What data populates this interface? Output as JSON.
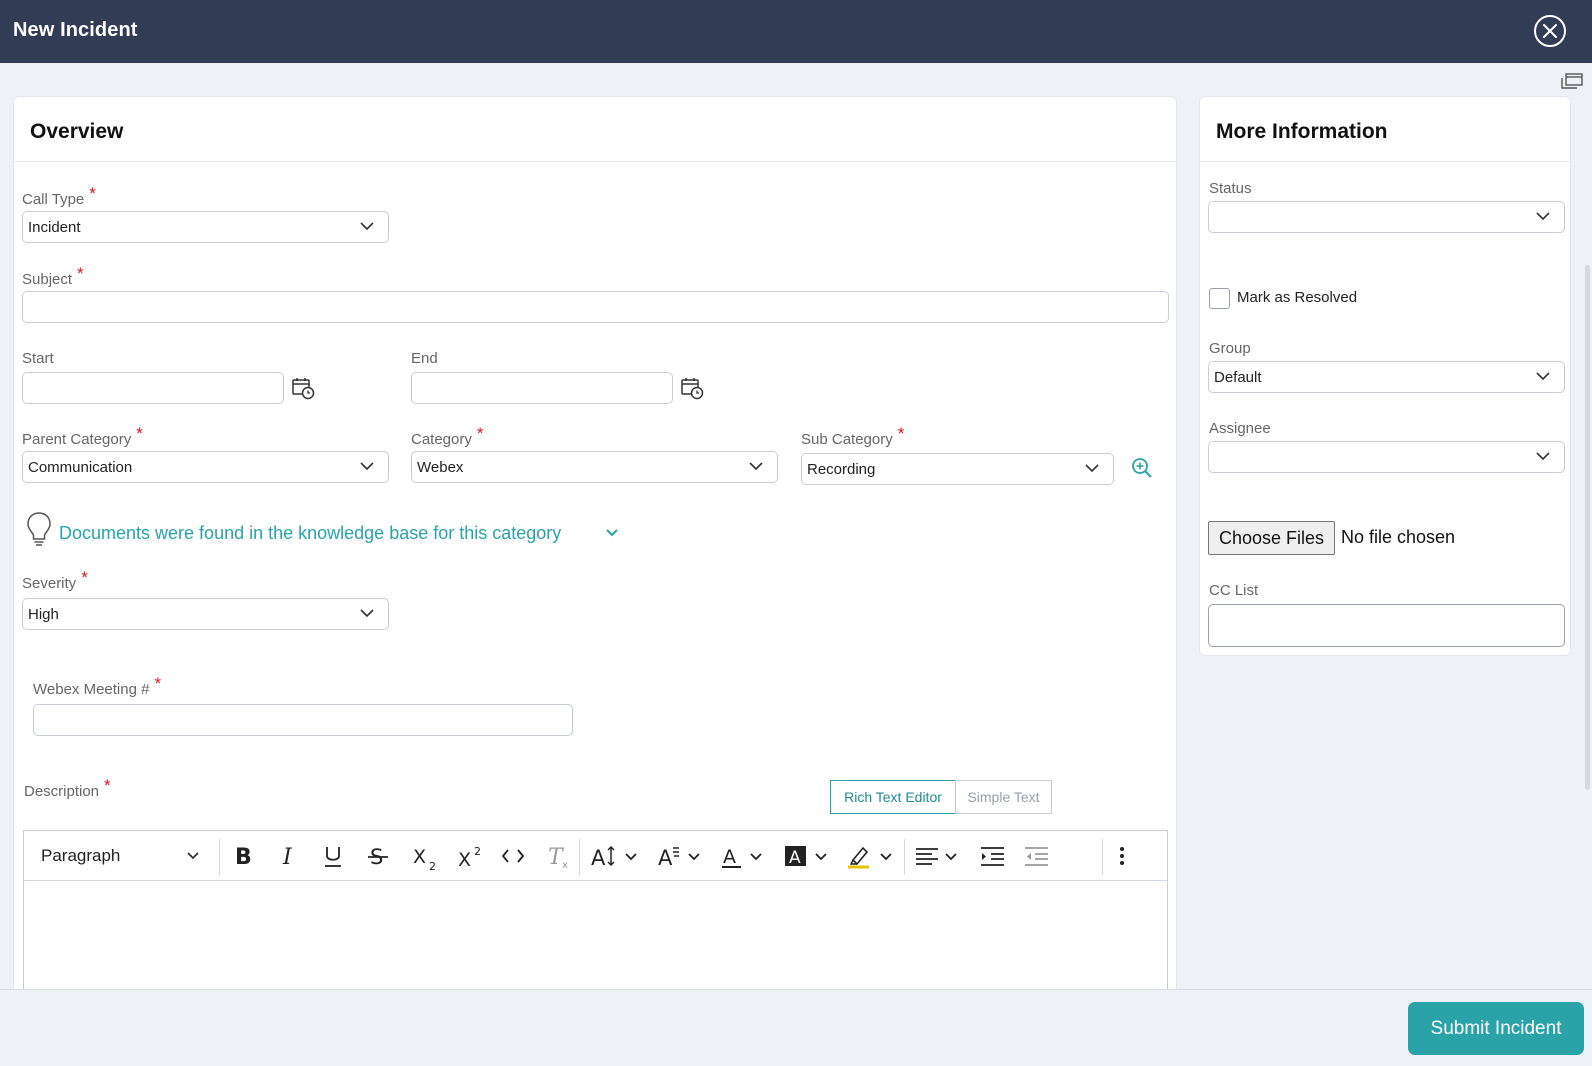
{
  "window": {
    "title": "New Incident"
  },
  "overview": {
    "title": "Overview",
    "call_type": {
      "label": "Call Type",
      "value": "Incident"
    },
    "subject": {
      "label": "Subject",
      "value": ""
    },
    "start": {
      "label": "Start",
      "value": ""
    },
    "end": {
      "label": "End",
      "value": ""
    },
    "parent_category": {
      "label": "Parent Category",
      "value": "Communication"
    },
    "category": {
      "label": "Category",
      "value": "Webex"
    },
    "sub_category": {
      "label": "Sub Category",
      "value": "Recording"
    },
    "knowledge_base": {
      "message": "Documents were found in the knowledge base for this category"
    },
    "severity": {
      "label": "Severity",
      "value": "High"
    },
    "webex_meeting": {
      "label": "Webex Meeting #",
      "value": ""
    },
    "description": {
      "label": "Description",
      "mode_rich": "Rich Text Editor",
      "mode_simple": "Simple Text",
      "active_mode": "Rich Text Editor",
      "paragraph_style": "Paragraph"
    },
    "required_marker": "*"
  },
  "more_info": {
    "title": "More Information",
    "status": {
      "label": "Status",
      "value": ""
    },
    "mark_resolved": {
      "label": "Mark as Resolved",
      "checked": false
    },
    "group": {
      "label": "Group",
      "value": "Default"
    },
    "assignee": {
      "label": "Assignee",
      "value": ""
    },
    "files": {
      "button": "Choose Files",
      "status": "No file chosen"
    },
    "cc_list": {
      "label": "CC List",
      "value": ""
    }
  },
  "footer": {
    "submit_label": "Submit Incident"
  },
  "colors": {
    "header_bg": "#323c54",
    "accent": "#2aa3a8",
    "required": "#d9161f",
    "page_bg": "#eff1f6"
  },
  "icons": [
    "close-icon",
    "popout-icon",
    "calendar-icon",
    "zoom-in-icon",
    "lightbulb-icon",
    "chevron-down-icon"
  ]
}
